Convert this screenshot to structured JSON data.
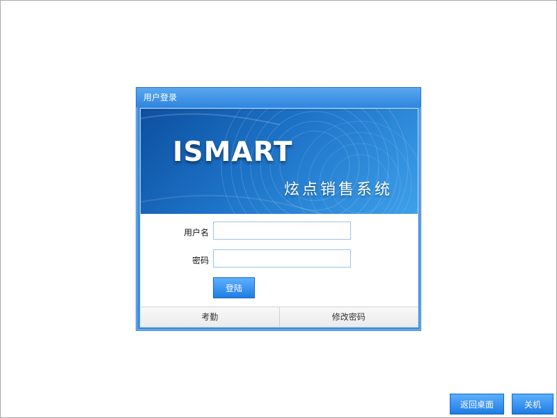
{
  "dialog": {
    "title": "用户登录"
  },
  "banner": {
    "brand": "ISMART",
    "subtitle": "炫点销售系统"
  },
  "form": {
    "username_label": "用户名",
    "username_value": "",
    "password_label": "密码",
    "password_value": "",
    "login_button": "登陆"
  },
  "footer": {
    "attendance": "考勤",
    "change_password": "修改密码"
  },
  "desktop": {
    "return_desktop": "返回桌面",
    "shutdown": "关机"
  },
  "colors": {
    "accent": "#2f86de",
    "button_blue": "#1e7de3",
    "banner_dark": "#0d4f9f",
    "banner_light": "#3ea0ea"
  }
}
